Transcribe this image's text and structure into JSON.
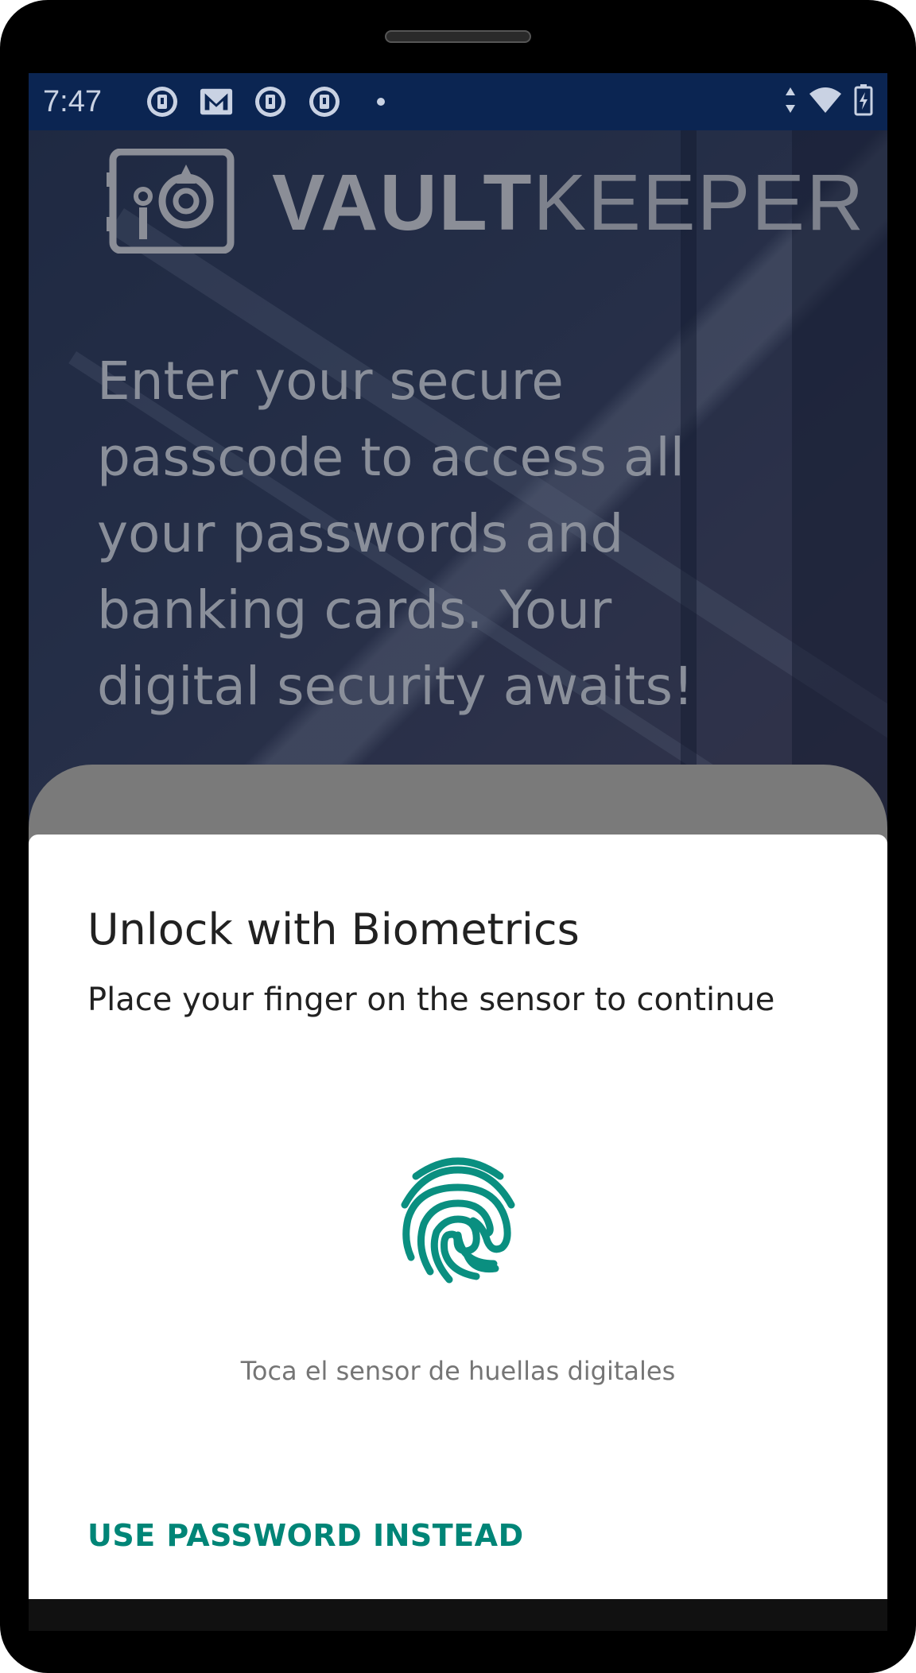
{
  "status_bar": {
    "time": "7:47",
    "left_icons": [
      "vault-notification-icon",
      "gmail-icon",
      "vault-notification-icon",
      "vault-notification-icon",
      "more-dot-icon"
    ],
    "right_icons": [
      "data-arrows-icon",
      "wifi-icon",
      "battery-charging-icon"
    ]
  },
  "app": {
    "logo_bold": "VAULT",
    "logo_light": "KEEPER",
    "intro_text": "Enter your secure\npasscode to access all\nyour passwords and\nbanking cards. Your\ndigital security awaits!"
  },
  "biometric_dialog": {
    "title": "Unlock with Biometrics",
    "subtitle": "Place your finger on the sensor to continue",
    "fingerprint_icon": "fingerprint-icon",
    "hint": "Toca el sensor de huellas digitales",
    "alt_button_label": "USE PASSWORD INSTEAD"
  },
  "colors": {
    "accent": "#008577",
    "status_bar": "#0b2552",
    "dialog_bg": "#ffffff",
    "title_text": "#212121",
    "hint_text": "#757575"
  }
}
